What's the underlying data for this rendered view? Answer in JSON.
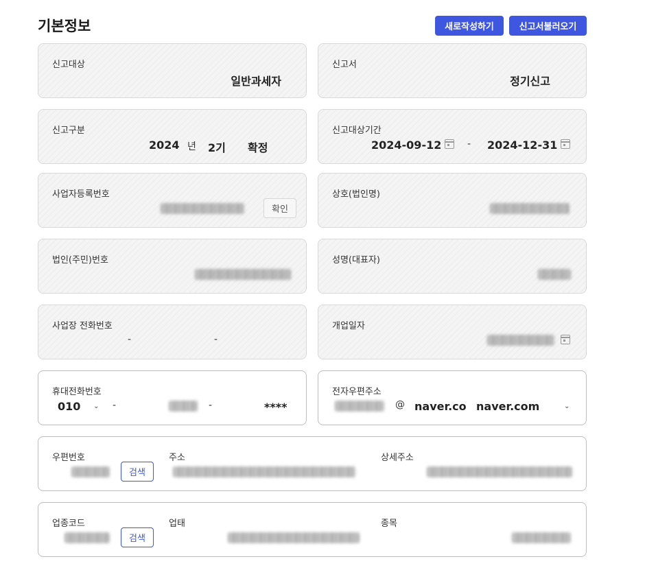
{
  "page": {
    "title": "기본정보"
  },
  "actions": {
    "new_label": "새로작성하기",
    "load_label": "신고서불러오기"
  },
  "report_target": {
    "label": "신고대상",
    "value": "일반과세자"
  },
  "report_form": {
    "label": "신고서",
    "value": "정기신고"
  },
  "report_type": {
    "label": "신고구분",
    "year": "2024",
    "year_unit": "년",
    "period": "2기",
    "kind": "확정"
  },
  "report_period": {
    "label": "신고대상기간",
    "start": "2024-09-12",
    "separator": "-",
    "end": "2024-12-31"
  },
  "business_reg": {
    "label": "사업자등록번호",
    "confirm_label": "확인"
  },
  "company_name": {
    "label": "상호(법인명)"
  },
  "corp_number": {
    "label": "법인(주민)번호"
  },
  "representative": {
    "label": "성명(대표자)"
  },
  "business_phone": {
    "label": "사업장 전화번호",
    "sep1": "-",
    "sep2": "-"
  },
  "open_date": {
    "label": "개업일자"
  },
  "mobile": {
    "label": "휴대전화번호",
    "prefix": "010",
    "sep1": "-",
    "sep2": "-",
    "last": "****"
  },
  "email": {
    "label": "전자우편주소",
    "at": "@",
    "domain": "naver.co",
    "domain_select": "naver.com"
  },
  "address": {
    "zip_label": "우편번호",
    "search_label": "검색",
    "addr_label": "주소",
    "detail_label": "상세주소"
  },
  "industry": {
    "code_label": "업종코드",
    "search_label": "검색",
    "type_label": "업태",
    "item_label": "종목"
  }
}
